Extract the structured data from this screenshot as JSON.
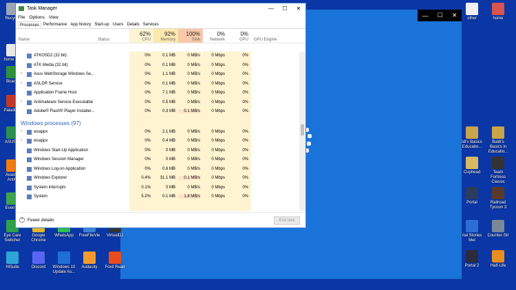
{
  "window": {
    "title": "Task Manager",
    "menu": [
      "File",
      "Options",
      "View"
    ],
    "tabs": [
      "Processes",
      "Performance",
      "App history",
      "Start-up",
      "Users",
      "Details",
      "Services"
    ],
    "controls": {
      "minimize": "—",
      "maximize": "☐",
      "close": "✕"
    }
  },
  "columns": {
    "name": "Name",
    "status": "Status",
    "cpu": {
      "pct": "62%",
      "label": "CPU"
    },
    "memory": {
      "pct": "92%",
      "label": "Memory"
    },
    "disk": {
      "pct": "100%",
      "label": "Disk"
    },
    "network": {
      "pct": "0%",
      "label": "Network"
    },
    "gpu": {
      "pct": "0%",
      "label": "GPU"
    },
    "gpu_engine": "GPU Engine"
  },
  "background_rows": [
    {
      "name": "ATKOSD2 (32 bit)",
      "cpu": "0%",
      "mem": "0.1 MB",
      "disk": "0 MB/s",
      "net": "0 Mbps",
      "gpu": "0%",
      "expand": false
    },
    {
      "name": "ATK Media (32 bit)",
      "cpu": "0%",
      "mem": "0.1 MB",
      "disk": "0 MB/s",
      "net": "0 Mbps",
      "gpu": "0%",
      "expand": false
    },
    {
      "name": "Asus WebStorage Windows Se...",
      "cpu": "0%",
      "mem": "1.1 MB",
      "disk": "0 MB/s",
      "net": "0 Mbps",
      "gpu": "0%",
      "expand": true
    },
    {
      "name": "ASLDR Service",
      "cpu": "0%",
      "mem": "0.1 MB",
      "disk": "0 MB/s",
      "net": "0 Mbps",
      "gpu": "0%",
      "expand": true
    },
    {
      "name": "Application Frame Host",
      "cpu": "0%",
      "mem": "7.1 MB",
      "disk": "0 MB/s",
      "net": "0 Mbps",
      "gpu": "0%",
      "expand": false
    },
    {
      "name": "Antimalware Service Executable",
      "cpu": "0%",
      "mem": "0.5 MB",
      "disk": "0 MB/s",
      "net": "0 Mbps",
      "gpu": "0%",
      "expand": true
    },
    {
      "name": "Adobe® Flash® Player Installer...",
      "cpu": "0%",
      "mem": "0.3 MB",
      "disk": "0.1 MB/s",
      "net": "0 Mbps",
      "gpu": "0%",
      "expand": false
    }
  ],
  "group": {
    "title": "Windows processes (97)"
  },
  "windows_rows": [
    {
      "name": "wsappx",
      "cpu": "0%",
      "mem": "2.1 MB",
      "disk": "0 MB/s",
      "net": "0 Mbps",
      "gpu": "0%",
      "expand": true
    },
    {
      "name": "wsappx",
      "cpu": "0%",
      "mem": "0.4 MB",
      "disk": "0 MB/s",
      "net": "0 Mbps",
      "gpu": "0%",
      "expand": true
    },
    {
      "name": "Windows Start-Up Application",
      "cpu": "0%",
      "mem": "0 MB",
      "disk": "0 MB/s",
      "net": "0 Mbps",
      "gpu": "0%",
      "expand": false
    },
    {
      "name": "Windows Session Manager",
      "cpu": "0%",
      "mem": "0 MB",
      "disk": "0 MB/s",
      "net": "0 Mbps",
      "gpu": "0%",
      "expand": false
    },
    {
      "name": "Windows Log-on Application",
      "cpu": "0%",
      "mem": "0.6 MB",
      "disk": "0 MB/s",
      "net": "0 Mbps",
      "gpu": "0%",
      "expand": false
    },
    {
      "name": "Windows Explorer",
      "cpu": "0.4%",
      "mem": "31.1 MB",
      "disk": "0.1 MB/s",
      "net": "0 Mbps",
      "gpu": "0%",
      "expand": false
    },
    {
      "name": "System interrupts",
      "cpu": "0.1%",
      "mem": "0 MB",
      "disk": "0 MB/s",
      "net": "0 Mbps",
      "gpu": "0%",
      "expand": false
    },
    {
      "name": "System",
      "cpu": "5.2%",
      "mem": "0.1 MB",
      "disk": "1.8 MB/s",
      "net": "0 Mbps",
      "gpu": "0%",
      "expand": false
    }
  ],
  "footer": {
    "fewer": "Fewer details",
    "end_task": "End task"
  },
  "desktop_icons": [
    {
      "label": "Recycle",
      "color": "#9aa6b8"
    },
    {
      "label": "home (H)",
      "color": "#e8e8e8"
    },
    {
      "label": "BlueSt",
      "color": "#2d8f3a"
    },
    {
      "label": "Paladium",
      "color": "#c0392b"
    },
    {
      "label": "ASUS H",
      "color": "#2b8f4e"
    },
    {
      "label": "Avast F Antivi",
      "color": "#f07b12"
    },
    {
      "label": "Evernot",
      "color": "#3fa34d"
    },
    {
      "label": "Eye Care Switcher",
      "color": "#2fa14a"
    },
    {
      "label": "Google Chrome",
      "color": "#e9b52a"
    },
    {
      "label": "WhatsApp",
      "color": "#2fbf50"
    },
    {
      "label": "FreeFileVie",
      "color": "#3b82d6"
    },
    {
      "label": "VirtualDJ",
      "color": "#333333"
    },
    {
      "label": "HiSuite",
      "color": "#2fa4d8"
    },
    {
      "label": "Discord",
      "color": "#5865f2"
    },
    {
      "label": "Windows 10 Update As...",
      "color": "#1f6fd6"
    },
    {
      "label": "Audacity",
      "color": "#f29a2e"
    },
    {
      "label": "Foxit Read",
      "color": "#e74c1c"
    },
    {
      "label": "other",
      "color": "#f0f0f0"
    },
    {
      "label": "home",
      "color": "#d9534f"
    },
    {
      "label": "ldi's Basics Educatio...",
      "color": "#c8a54a"
    },
    {
      "label": "Baldi's Basics in Educatio...",
      "color": "#c8a54a"
    },
    {
      "label": "Cuphead",
      "color": "#d8b860"
    },
    {
      "label": "Team Fortress Classic",
      "color": "#333333"
    },
    {
      "label": "Portal",
      "color": "#2b3c5e"
    },
    {
      "label": "Railroad Tycoon 3",
      "color": "#5a3a2a"
    },
    {
      "label": "rtal Stories Mel",
      "color": "#2b6fd6"
    },
    {
      "label": "Counter-Str",
      "color": "#7a8898"
    },
    {
      "label": "Portal 2",
      "color": "#2b2b3c"
    },
    {
      "label": "Half-Life",
      "color": "#e98f1c"
    }
  ],
  "blue_window_controls": {
    "minimize": "—",
    "maximize": "☐",
    "close": "✕"
  }
}
